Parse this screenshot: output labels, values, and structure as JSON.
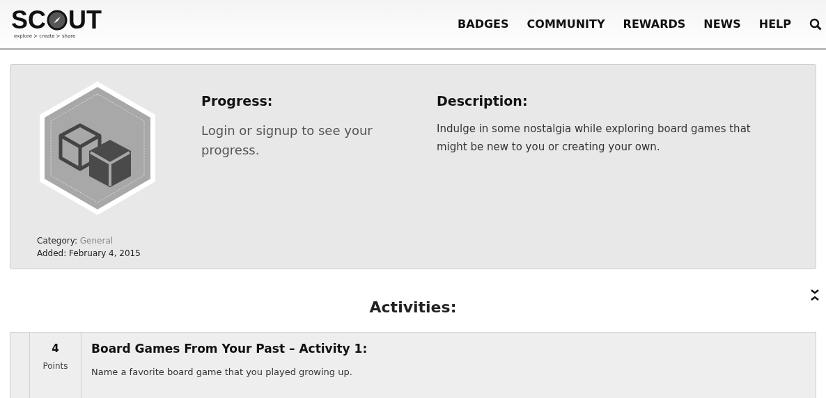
{
  "logo": {
    "left": "SC",
    "right": "UT",
    "tagline": "explore ≻ create ≻ share"
  },
  "nav": [
    "BADGES",
    "COMMUNITY",
    "REWARDS",
    "NEWS",
    "HELP"
  ],
  "badge": {
    "category_label": "Category:",
    "category": "General",
    "added": "Added: February 4, 2015"
  },
  "progress": {
    "title": "Progress:",
    "text": "Login or signup to see your progress."
  },
  "description": {
    "title": "Description:",
    "text": "Indulge in some nostalgia while exploring board games that might be new to you or creating your own."
  },
  "activities": {
    "title": "Activities:",
    "items": [
      {
        "points": "4",
        "points_label": "Points",
        "title": "Board Games From Your Past – Activity 1:",
        "text": "Name a favorite board game that you played growing up."
      }
    ]
  }
}
